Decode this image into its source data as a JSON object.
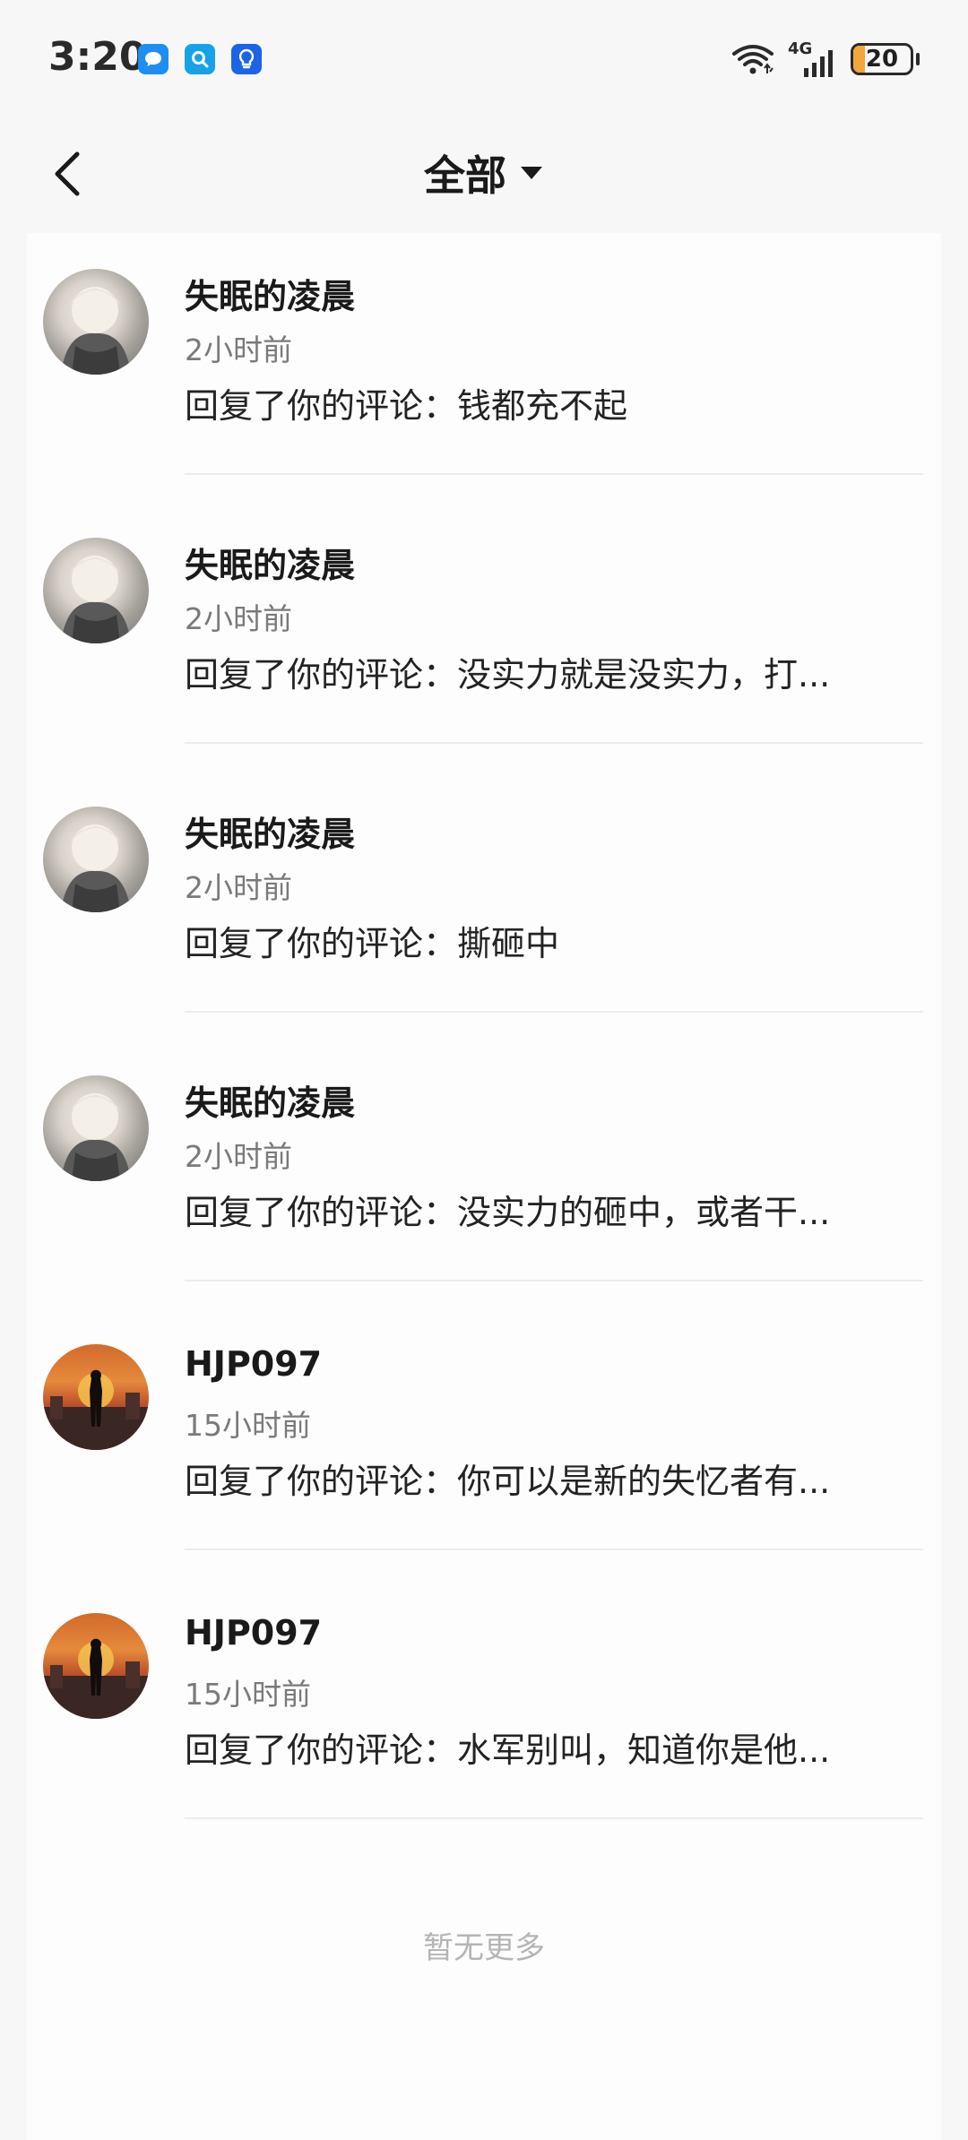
{
  "status_bar": {
    "time": "3:20",
    "network": "4G",
    "battery": "20",
    "battery_level": 0.2,
    "icons": [
      "message-app-icon",
      "search-app-icon",
      "bulb-app-icon",
      "wifi-icon",
      "signal-icon",
      "battery-icon"
    ],
    "colors": {
      "message_app": "#1f8ef1",
      "search_app": "#17a2e8",
      "bulb_app": "#1c63e6",
      "battery_fill": "#f2a73b"
    }
  },
  "header": {
    "back_icon": "back-chevron-icon",
    "title": "全部",
    "dropdown_icon": "caret-down-icon"
  },
  "notifications": [
    {
      "username": "失眠的凌晨",
      "time": "2小时前",
      "text": "回复了你的评论：钱都充不起",
      "avatar": "avatar-a"
    },
    {
      "username": "失眠的凌晨",
      "time": "2小时前",
      "text": "回复了你的评论：没实力就是没实力，打...",
      "avatar": "avatar-a"
    },
    {
      "username": "失眠的凌晨",
      "time": "2小时前",
      "text": "回复了你的评论：撕砸中",
      "avatar": "avatar-a"
    },
    {
      "username": "失眠的凌晨",
      "time": "2小时前",
      "text": "回复了你的评论：没实力的砸中，或者干...",
      "avatar": "avatar-a"
    },
    {
      "username": "HJP097",
      "time": "15小时前",
      "text": "回复了你的评论：你可以是新的失忆者有...",
      "avatar": "avatar-b"
    },
    {
      "username": "HJP097",
      "time": "15小时前",
      "text": "回复了你的评论：水军别叫，知道你是他...",
      "avatar": "avatar-b"
    }
  ],
  "footer": {
    "no_more": "暂无更多"
  }
}
